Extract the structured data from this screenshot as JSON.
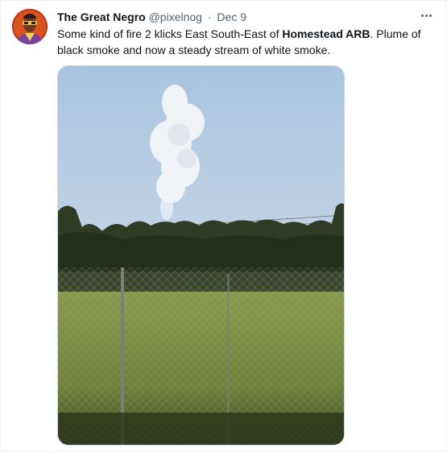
{
  "tweet": {
    "author": {
      "display_name": "The Great Negro",
      "handle": "@pixelnog"
    },
    "separator": "·",
    "date": "Dec 9",
    "text": {
      "part1": "Some kind of fire 2 klicks East South-East of ",
      "bold": "Homestead ARB",
      "part2": ". Plume of black smoke and now a steady stream of white smoke."
    },
    "more_icon": "more-horizontal-icon",
    "photo": {
      "subject": "white smoke plume above tree line behind chain-link fence and grass field"
    }
  },
  "colors": {
    "text_primary": "#0f1419",
    "text_secondary": "#536471",
    "border": "#cfd9de"
  }
}
